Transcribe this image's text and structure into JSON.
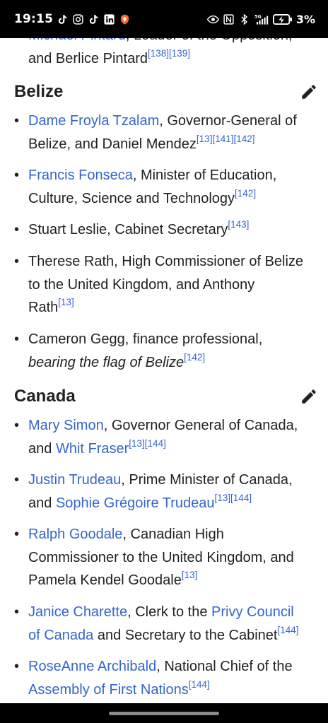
{
  "status_bar": {
    "time": "19:15",
    "battery": "3%",
    "left_icons": [
      "tiktok-icon",
      "instagram-icon",
      "tiktok-icon",
      "linkedin-icon",
      "brave-icon"
    ],
    "right_icons": [
      "eye-icon",
      "nfc-icon",
      "bluetooth-icon",
      "signal-5g-icon",
      "battery-charging-icon"
    ],
    "network": "5G"
  },
  "top_partial": {
    "line1_link": "Michael Pintard",
    "line1_text": ", Leader of the Opposition,",
    "line2_text": "and Berlice Pintard",
    "refs": "[138][139]"
  },
  "sections": {
    "belize": {
      "heading": "Belize",
      "items": [
        {
          "link": "Dame Froyla Tzalam",
          "text": ", Governor-General of",
          "text2": "Belize, and Daniel Mendez",
          "refs": "[13][141][142]"
        },
        {
          "link": "Francis Fonseca",
          "text": ", Minister of Education,",
          "text2": "Culture, Science and Technology",
          "refs": "[142]"
        },
        {
          "text": "Stuart Leslie, Cabinet Secretary",
          "refs": "[143]"
        },
        {
          "text": "Therese Rath, High Commissioner of Belize",
          "text2": "to the United Kingdom, and Anthony",
          "text3": "Rath",
          "refs": "[13]"
        },
        {
          "text": "Cameron Gegg, finance professional,",
          "italic": "bearing the flag of Belize",
          "refs": "[142]"
        }
      ]
    },
    "canada": {
      "heading": "Canada",
      "items": [
        {
          "link": "Mary Simon",
          "text": ", Governor General of Canada,",
          "text2": "and ",
          "link2": "Whit Fraser",
          "refs": "[13][144]"
        },
        {
          "link": "Justin Trudeau",
          "text": ", Prime Minister of Canada,",
          "text2": "and ",
          "link2": "Sophie Grégoire Trudeau",
          "refs": "[13][144]"
        },
        {
          "link": "Ralph Goodale",
          "text": ", Canadian High",
          "text2": "Commissioner to the United Kingdom, and",
          "text3": "Pamela Kendel Goodale",
          "refs": "[13]"
        },
        {
          "link": "Janice Charette",
          "text": ", Clerk to the ",
          "link2": "Privy Council",
          "link3": "of Canada",
          "text2": " and Secretary to the Cabinet",
          "refs": "[144]"
        },
        {
          "link": "RoseAnne Archibald",
          "text": ", National Chief of the",
          "link2": "Assembly of First Nations",
          "refs": "[144]"
        }
      ]
    }
  },
  "colors": {
    "link": "#3366cc",
    "text": "#202122",
    "background": "#ffffff",
    "status_bar": "#000000"
  }
}
